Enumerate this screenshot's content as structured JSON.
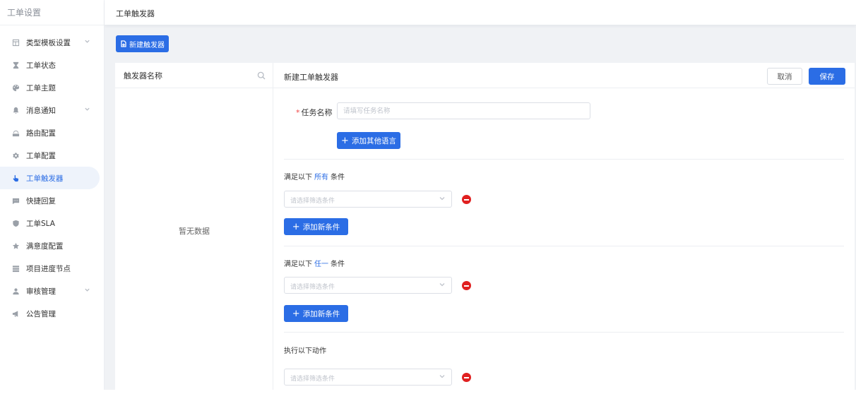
{
  "sidebar": {
    "title": "工单设置",
    "items": [
      {
        "label": "类型模板设置",
        "icon": "template-icon",
        "has_children": true
      },
      {
        "label": "工单状态",
        "icon": "hourglass-icon",
        "has_children": false
      },
      {
        "label": "工单主题",
        "icon": "palette-icon",
        "has_children": false
      },
      {
        "label": "消息通知",
        "icon": "bell-icon",
        "has_children": true
      },
      {
        "label": "路由配置",
        "icon": "router-icon",
        "has_children": false
      },
      {
        "label": "工单配置",
        "icon": "gear-icon",
        "has_children": false
      },
      {
        "label": "工单触发器",
        "icon": "pointer-hand-icon",
        "has_children": false,
        "active": true
      },
      {
        "label": "快捷回复",
        "icon": "message-icon",
        "has_children": false
      },
      {
        "label": "工单SLA",
        "icon": "shield-icon",
        "has_children": false
      },
      {
        "label": "满意度配置",
        "icon": "star-icon",
        "has_children": false
      },
      {
        "label": "项目进度节点",
        "icon": "list-icon",
        "has_children": false
      },
      {
        "label": "审核管理",
        "icon": "user-icon",
        "has_children": true
      },
      {
        "label": "公告管理",
        "icon": "megaphone-icon",
        "has_children": false
      }
    ]
  },
  "header": {
    "title": "工单触发器"
  },
  "toolbar": {
    "new_label": "新建触发器"
  },
  "list_panel": {
    "header": "触发器名称",
    "empty_text": "暂无数据"
  },
  "form": {
    "title": "新建工单触发器",
    "cancel_label": "取消",
    "save_label": "保存",
    "task_name_label": "任务名称",
    "task_name_placeholder": "请填写任务名称",
    "add_language_label": "添加其他语言",
    "section_all": {
      "prefix": "满足以下",
      "keyword": "所有",
      "suffix": "条件"
    },
    "section_any": {
      "prefix": "满足以下",
      "keyword": "任一",
      "suffix": "条件"
    },
    "select_placeholder": "请选择筛选条件",
    "add_condition_label": "添加新条件",
    "actions_title": "执行以下动作"
  },
  "colors": {
    "primary": "#2b6de5",
    "danger": "#e02020",
    "background": "#f0f2f5"
  }
}
